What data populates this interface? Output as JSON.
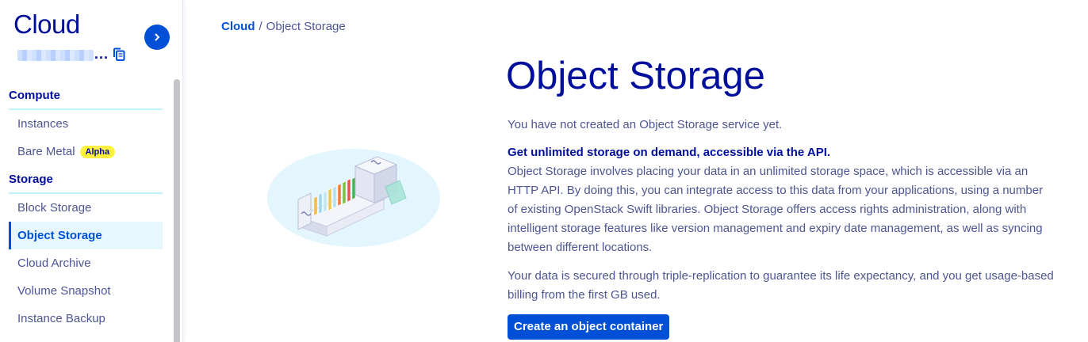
{
  "sidebar": {
    "title": "Cloud",
    "project_suffix": "...",
    "sections": [
      {
        "label": "Compute",
        "items": [
          {
            "label": "Instances"
          },
          {
            "label": "Bare Metal",
            "badge": "Alpha"
          }
        ]
      },
      {
        "label": "Storage",
        "items": [
          {
            "label": "Block Storage"
          },
          {
            "label": "Object Storage",
            "active": true
          },
          {
            "label": "Cloud Archive"
          },
          {
            "label": "Volume Snapshot"
          },
          {
            "label": "Instance Backup"
          }
        ]
      }
    ]
  },
  "breadcrumb": {
    "root": "Cloud",
    "separator": "/",
    "current": "Object Storage"
  },
  "main": {
    "title": "Object Storage",
    "intro": "You have not created an Object Storage service yet.",
    "headline": "Get unlimited storage on demand, accessible via the API.",
    "description": "Object Storage involves placing your data in an unlimited storage space, which is accessible via an HTTP API. By doing this, you can integrate access to this data from your applications, using a number of existing OpenStack Swift libraries. Object Storage offers access rights administration, along with intelligent storage features like version management and expiry date management, as well as syncing between different locations.",
    "security": "Your data is secured through triple-replication to guarantee its life expectancy, and you get usage-based billing from the first GB used.",
    "cta_label": "Create an object container"
  },
  "colors": {
    "primary": "#0050d7",
    "heading": "#000e9c",
    "text": "#4d5592",
    "badge": "#fff23e",
    "active_bg": "#e6f7fd"
  }
}
